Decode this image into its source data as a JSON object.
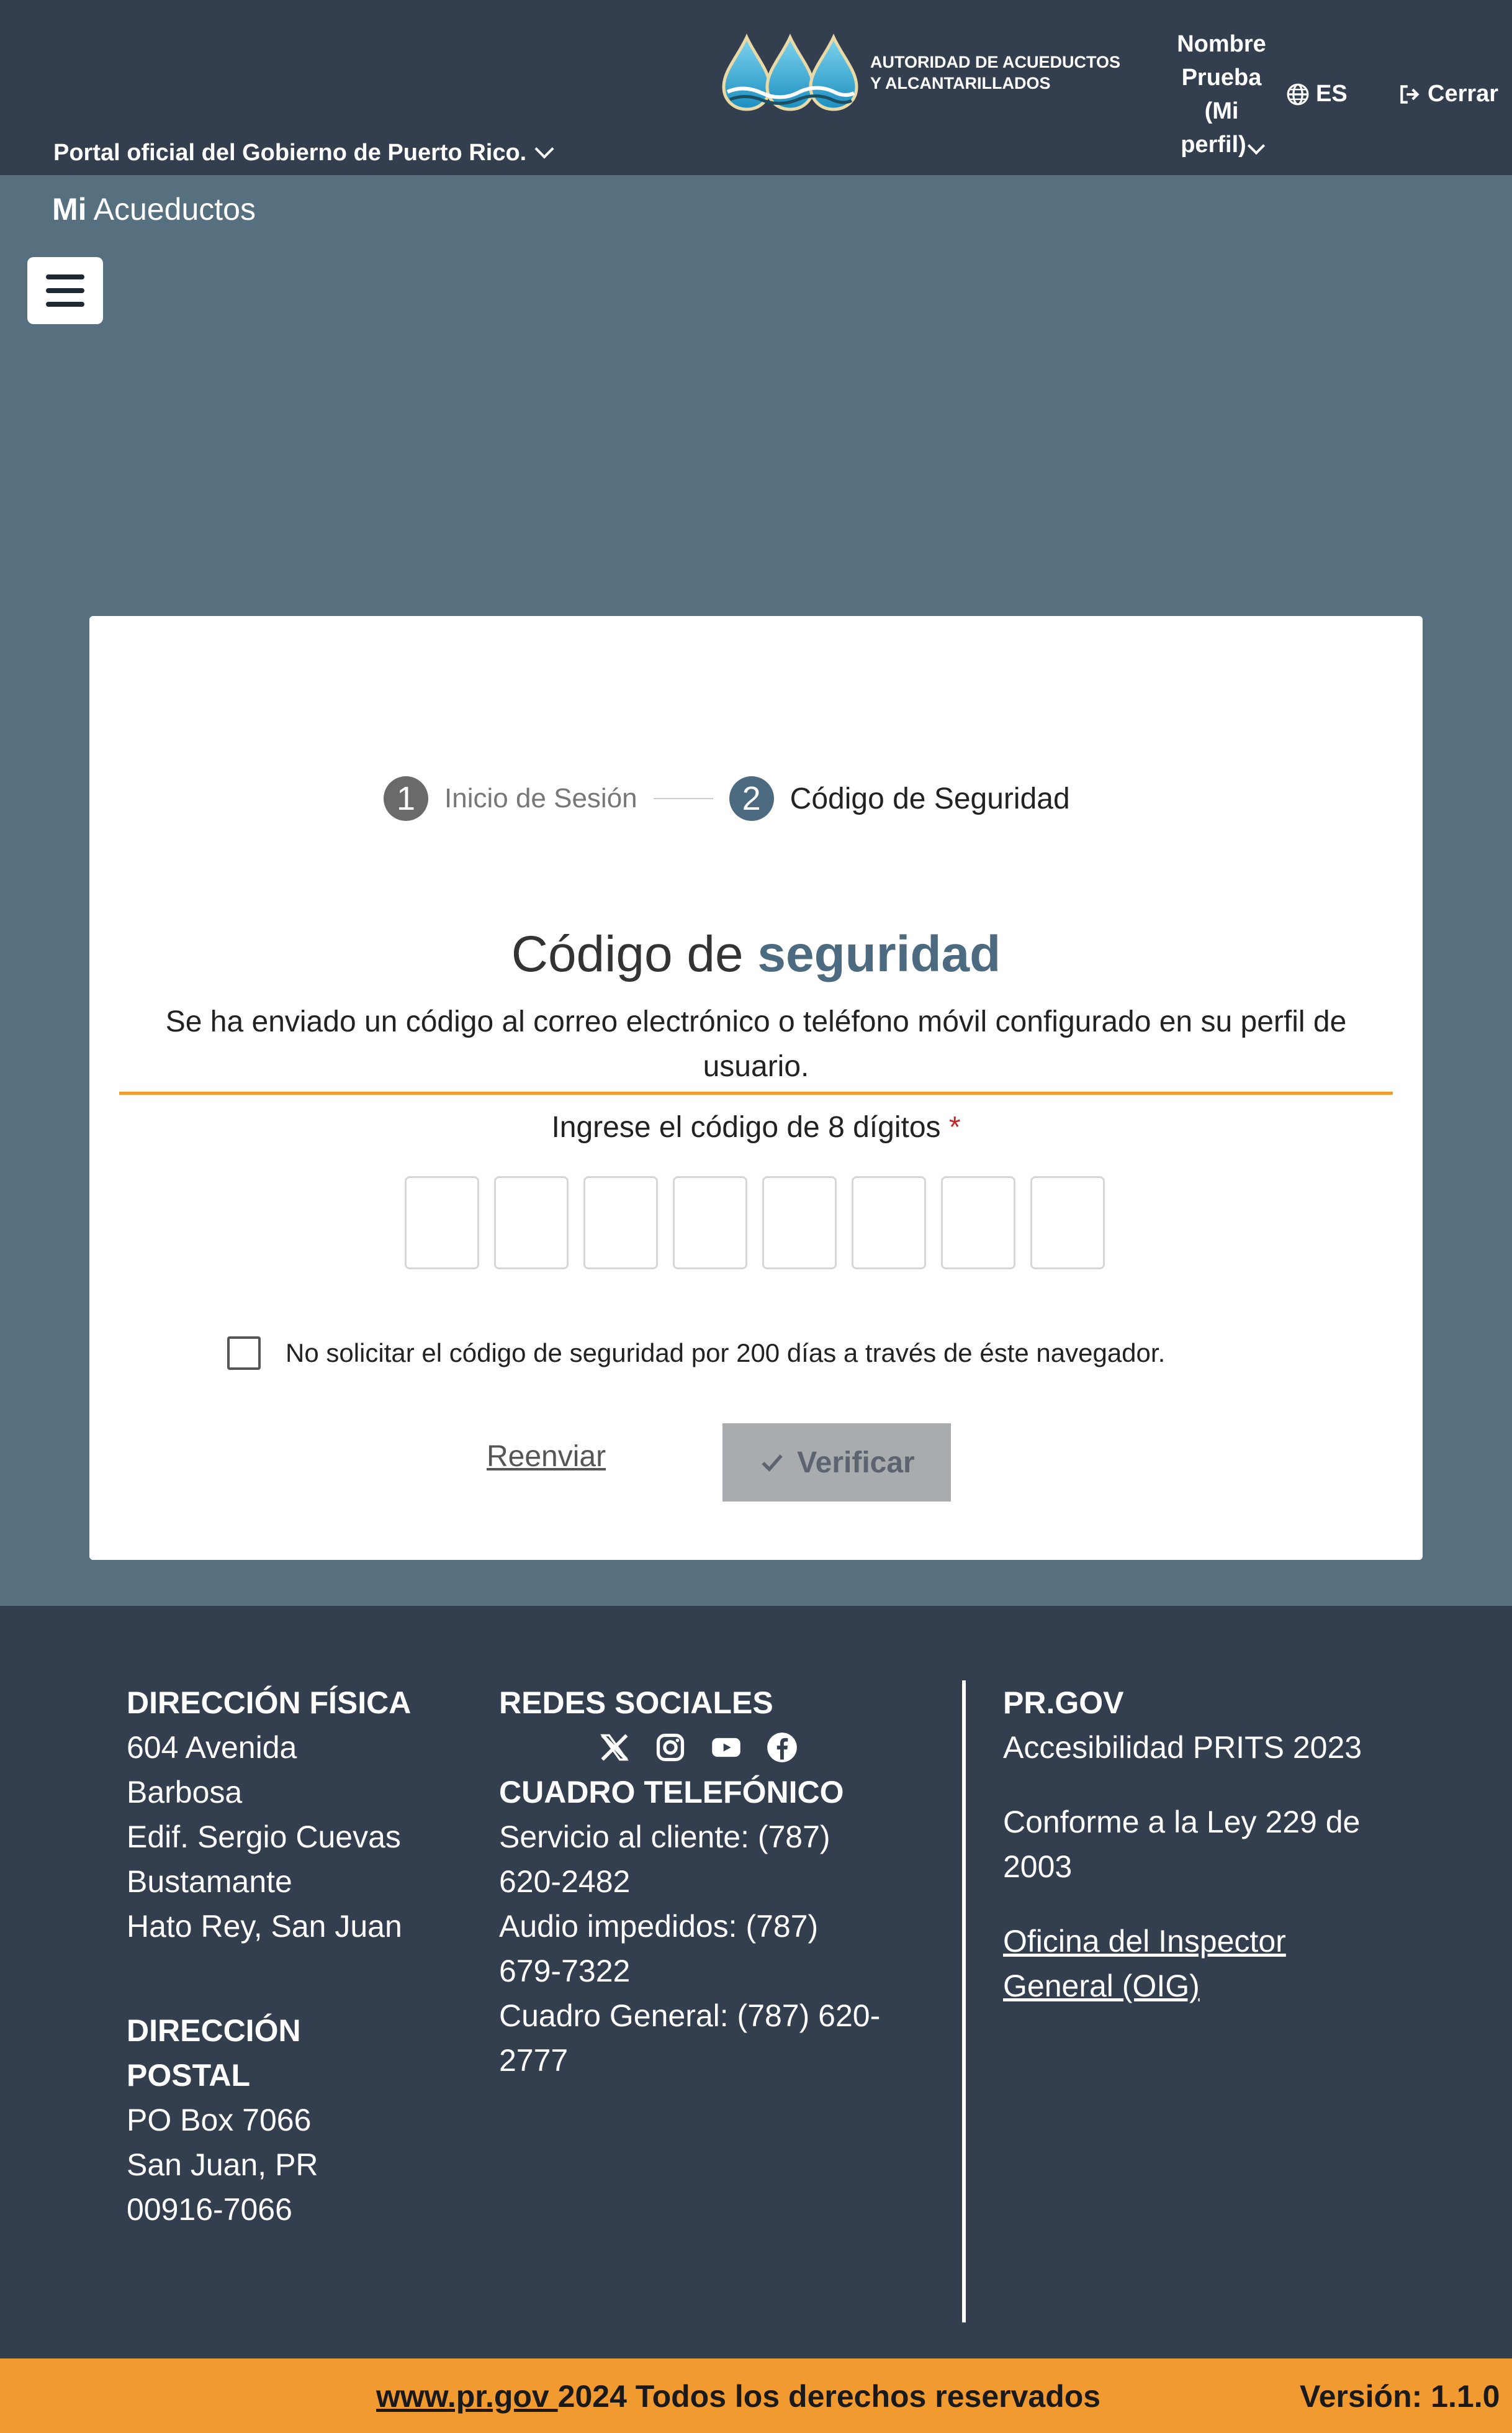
{
  "header": {
    "gov_portal": "Portal oficial del Gobierno de Puerto Rico.",
    "logo_line1": "Autoridad de Acueductos",
    "logo_line2": "y Alcantarillados",
    "profile_lines": [
      "Nombre",
      "Prueba",
      "(Mi",
      "perfil)"
    ],
    "language": "ES",
    "logout": "Cerrar"
  },
  "brand": {
    "bold": "Mi",
    "rest": " Acueductos"
  },
  "stepper": {
    "step1_num": "1",
    "step1_label": "Inicio de Sesión",
    "step2_num": "2",
    "step2_label": "Código de Seguridad"
  },
  "security": {
    "title_plain": "Código de ",
    "title_accent": "seguridad",
    "description": "Se ha enviado un código al correo electrónico o teléfono móvil configurado en su perfil de usuario.",
    "code_label": "Ingrese el código de 8 dígitos",
    "required_mark": "*",
    "remember_label": "No solicitar el código de seguridad por 200 días a través de éste navegador.",
    "resend": "Reenviar",
    "verify": "Verificar"
  },
  "footer": {
    "physical_title": "DIRECCIÓN FÍSICA",
    "physical_lines": [
      "604 Avenida",
      "Barbosa",
      "Edif. Sergio Cuevas",
      "Bustamante",
      "Hato Rey, San Juan"
    ],
    "postal_title_1": "DIRECCIÓN",
    "postal_title_2": "POSTAL",
    "postal_lines": [
      "PO Box 7066",
      "San Juan, PR",
      "00916-7066"
    ],
    "social_title": "REDES SOCIALES",
    "social_icons": [
      "x-icon",
      "instagram-icon",
      "youtube-icon",
      "facebook-icon"
    ],
    "phone_title": "CUADRO TELEFÓNICO",
    "phone_lines": [
      "Servicio al cliente: (787)",
      "620-2482",
      "Audio impedidos: (787)",
      "679-7322",
      "Cuadro General: (787) 620-",
      "2777"
    ],
    "prgov_title": "PR.GOV",
    "accessibility": "Accesibilidad PRITS 2023",
    "law_1": "Conforme a la Ley 229 de",
    "law_2": "2003",
    "oig_1": "Oficina del Inspector",
    "oig_2": "General (OIG)"
  },
  "bottom": {
    "site_link": "www.pr.gov ",
    "rights": "2024 Todos los derechos reservados",
    "version": "Versión: 1.1.0"
  },
  "colors": {
    "header_bg": "#333f4e",
    "page_bg": "#56707f",
    "accent_blue": "#4c6a80",
    "accent_orange": "#f09a30",
    "required_red": "#c0292b"
  }
}
